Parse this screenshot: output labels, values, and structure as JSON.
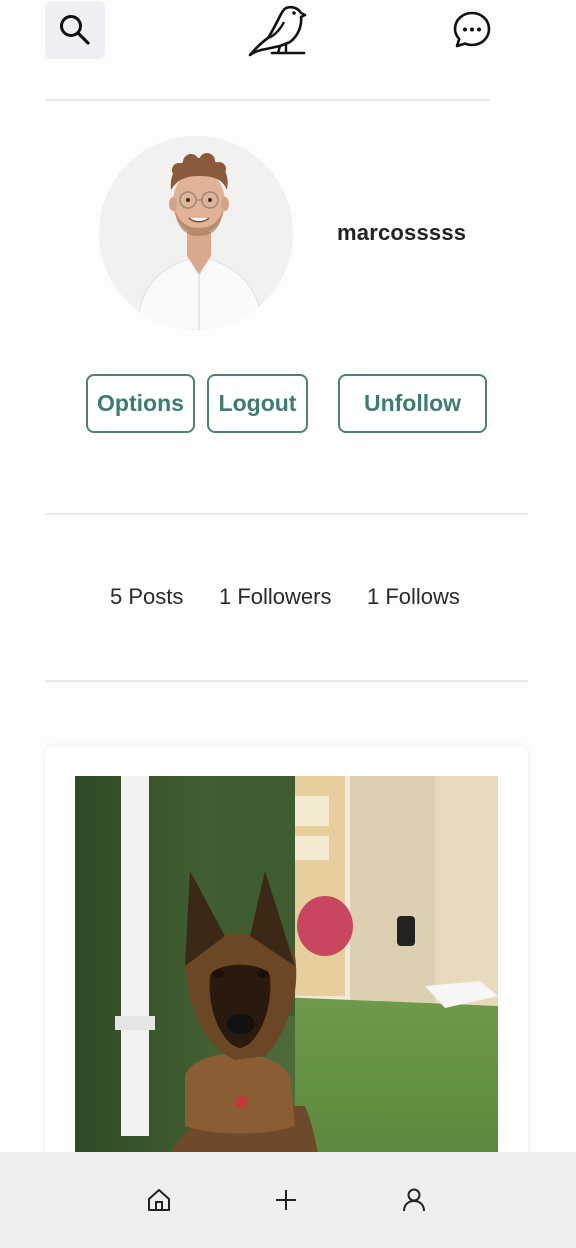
{
  "header": {
    "search_icon": "search-icon",
    "logo_icon": "bird-logo-icon",
    "messages_icon": "chat-bubble-icon"
  },
  "profile": {
    "username": "marcosssss",
    "avatar_icon": "profile-photo"
  },
  "actions": {
    "options_label": "Options",
    "logout_label": "Logout",
    "unfollow_label": "Unfollow"
  },
  "stats": {
    "posts": "5 Posts",
    "followers": "1 Followers",
    "follows": "1 Follows"
  },
  "post": {
    "image_icon": "dog-photo"
  },
  "bottom_nav": {
    "home_icon": "home-icon",
    "add_icon": "plus-icon",
    "profile_icon": "user-icon"
  },
  "colors": {
    "accent": "#3f7a73",
    "nav_background": "#efefef",
    "search_background": "#eef0f3"
  }
}
